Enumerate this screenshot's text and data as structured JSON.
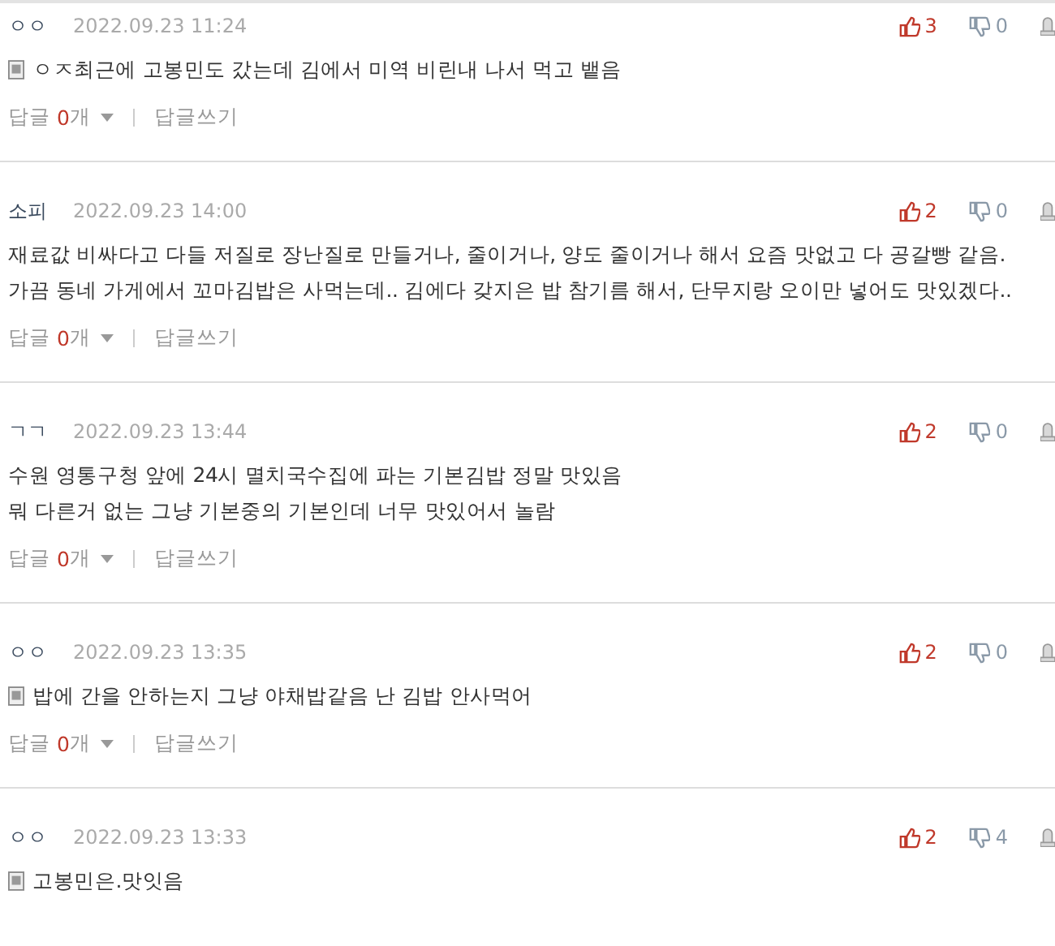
{
  "comments": [
    {
      "author": "ㅇㅇ",
      "date": "2022.09.23 11:24",
      "likes": "3",
      "dislikes": "0",
      "mobile": true,
      "text": "ㅇㅈ최근에 고봉민도 갔는데 김에서 미역 비린내 나서 먹고 뱉음",
      "replies": {
        "label": "답글",
        "count": "0",
        "unit": "개",
        "write": "답글쓰기"
      }
    },
    {
      "author": "소피",
      "date": "2022.09.23 14:00",
      "likes": "2",
      "dislikes": "0",
      "mobile": false,
      "text": "재료값 비싸다고 다들 저질로 장난질로 만들거나, 줄이거나, 양도 줄이거나 해서 요즘 맛없고 다 공갈빵 같음.\n가끔 동네 가게에서 꼬마김밥은 사먹는데.. 김에다 갖지은 밥 참기름 해서, 단무지랑 오이만 넣어도 맛있겠다..",
      "replies": {
        "label": "답글",
        "count": "0",
        "unit": "개",
        "write": "답글쓰기"
      }
    },
    {
      "author": "ㄱㄱ",
      "date": "2022.09.23 13:44",
      "likes": "2",
      "dislikes": "0",
      "mobile": false,
      "text": "수원 영통구청 앞에 24시 멸치국수집에 파는 기본김밥 정말 맛있음\n뭐 다른거 없는 그냥 기본중의 기본인데 너무 맛있어서 놀람",
      "replies": {
        "label": "답글",
        "count": "0",
        "unit": "개",
        "write": "답글쓰기"
      }
    },
    {
      "author": "ㅇㅇ",
      "date": "2022.09.23 13:35",
      "likes": "2",
      "dislikes": "0",
      "mobile": true,
      "text": "밥에 간을 안하는지 그냥 야채밥같음 난 김밥 안사먹어",
      "replies": {
        "label": "답글",
        "count": "0",
        "unit": "개",
        "write": "답글쓰기"
      }
    },
    {
      "author": "ㅇㅇ",
      "date": "2022.09.23 13:33",
      "likes": "2",
      "dislikes": "4",
      "mobile": true,
      "text": "고봉민은.맛잇음"
    }
  ]
}
